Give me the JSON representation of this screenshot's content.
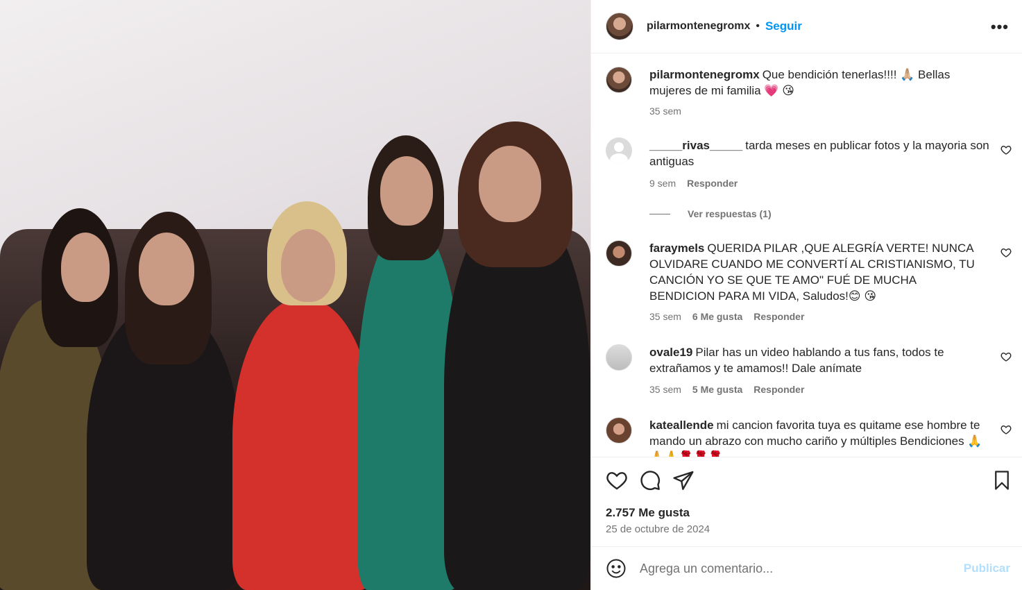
{
  "post": {
    "username": "pilarmontenegromx",
    "separator": "•",
    "follow_label": "Seguir",
    "more_label": "•••"
  },
  "caption": {
    "username": "pilarmontenegromx",
    "text": "Que bendición tenerlas!!!! 🙏🏼 Bellas mujeres de mi familia 💗 😘",
    "time": "35 sem"
  },
  "comments": [
    {
      "username": "_____rivas_____",
      "text": "tarda meses en publicar fotos y la mayoria son antiguas",
      "time": "9 sem",
      "likes": "",
      "reply_label": "Responder"
    },
    {
      "username": "faraymels",
      "text": "QUERIDA PILAR ,QUE ALEGRÍA VERTE! NUNCA OLVIDARE CUANDO ME CONVERTÍ AL CRISTIANISMO, TU CANCIÓN YO SE QUE TE AMO\" FUÉ DE MUCHA BENDICION PARA MI VIDA, Saludos!😊 😘",
      "time": "35 sem",
      "likes": "6 Me gusta",
      "reply_label": "Responder"
    },
    {
      "username": "ovale19",
      "text": "Pilar has un video hablando a tus fans, todos te extrañamos y te amamos!! Dale anímate",
      "time": "35 sem",
      "likes": "5 Me gusta",
      "reply_label": "Responder"
    },
    {
      "username": "kateallende",
      "text": "mi cancion favorita tuya es quitame ese hombre te mando un abrazo con mucho cariño y múltiples Bendiciones 🙏🙏🙏🌹🌹🌹",
      "time": "",
      "likes": "",
      "reply_label": ""
    }
  ],
  "view_replies": "Ver respuestas (1)",
  "likes_count": "2.757 Me gusta",
  "post_date": "25 de octubre de 2024",
  "add_comment": {
    "placeholder": "Agrega un comentario...",
    "post_label": "Publicar"
  },
  "colors": {
    "link_blue": "#0095f6",
    "muted": "#737373",
    "post_disabled": "#b2dffc"
  }
}
